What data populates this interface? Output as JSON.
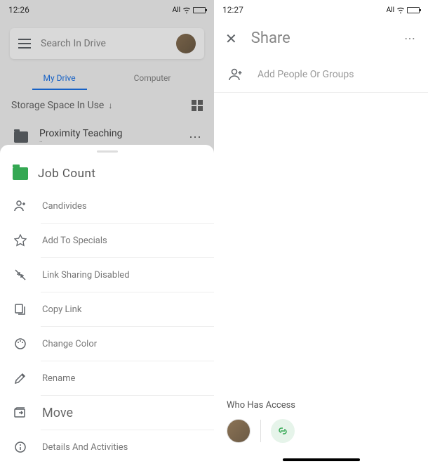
{
  "left": {
    "status": {
      "time": "12:26",
      "network": "All"
    },
    "search": {
      "placeholder": "Search In Drive"
    },
    "tabs": {
      "mydrive": "My Drive",
      "computer": "Computer"
    },
    "storage": {
      "label": "Storage Space In Use"
    },
    "folders": [
      {
        "name": "Proximity Teaching",
        "sub": "··"
      }
    ],
    "sheet": {
      "title": "Job Count",
      "items": {
        "candivides": "Candivides",
        "specials": "Add To Specials",
        "linksharing": "Link Sharing Disabled",
        "copylink": "Copy Link",
        "changecolor": "Change Color",
        "rename": "Rename",
        "move": "Move",
        "details": "Details And Activities"
      }
    }
  },
  "right": {
    "status": {
      "time": "12:27",
      "network": "All"
    },
    "share": {
      "title": "Share",
      "addPeople": "Add People Or Groups"
    },
    "access": {
      "label": "Who Has Access"
    }
  }
}
